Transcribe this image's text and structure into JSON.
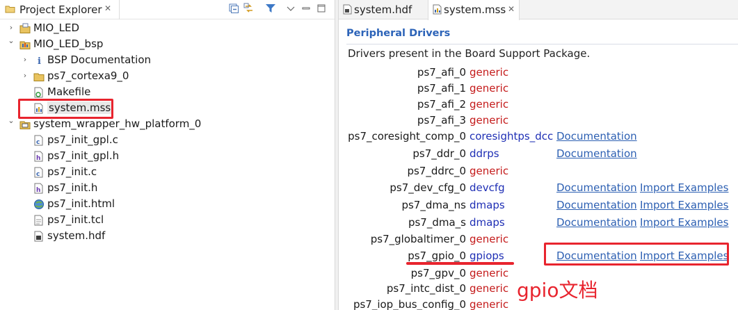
{
  "explorer": {
    "title": "Project Explorer",
    "close_glyph": "✕",
    "toolbar": [
      "collapse-all",
      "link-with-editor",
      "filter",
      "view-menu",
      "minimize",
      "maximize"
    ]
  },
  "tree": [
    {
      "label": "MIO_LED",
      "expanded": false,
      "icon": "project-folder-icon"
    },
    {
      "label": "MIO_LED_bsp",
      "expanded": true,
      "icon": "bsp-folder-icon"
    },
    {
      "label": "BSP Documentation",
      "expanded": false,
      "icon": "info-icon"
    },
    {
      "label": "ps7_cortexa9_0",
      "expanded": false,
      "icon": "folder-icon"
    },
    {
      "label": "Makefile",
      "icon": "makefile-icon"
    },
    {
      "label": "system.mss",
      "icon": "mss-file-icon",
      "selected": true
    },
    {
      "label": "system_wrapper_hw_platform_0",
      "expanded": true,
      "icon": "hw-platform-icon"
    },
    {
      "label": "ps7_init_gpl.c",
      "icon": "c-file-icon"
    },
    {
      "label": "ps7_init_gpl.h",
      "icon": "h-file-icon"
    },
    {
      "label": "ps7_init.c",
      "icon": "c-file-icon"
    },
    {
      "label": "ps7_init.h",
      "icon": "h-file-icon"
    },
    {
      "label": "ps7_init.html",
      "icon": "html-file-icon"
    },
    {
      "label": "ps7_init.tcl",
      "icon": "tcl-file-icon"
    },
    {
      "label": "system.hdf",
      "icon": "hdf-file-icon"
    }
  ],
  "editor": {
    "tabs": [
      {
        "label": "system.hdf",
        "icon": "hdf-file-icon",
        "active": false
      },
      {
        "label": "system.mss",
        "icon": "mss-file-icon",
        "active": true,
        "close_glyph": "✕"
      }
    ],
    "section_title": "Peripheral Drivers",
    "section_desc": "Drivers present in the Board Support Package.",
    "drivers": [
      {
        "name": "ps7_afi_0",
        "driver": "generic",
        "kind": "generic"
      },
      {
        "name": "ps7_afi_1",
        "driver": "generic",
        "kind": "generic"
      },
      {
        "name": "ps7_afi_2",
        "driver": "generic",
        "kind": "generic"
      },
      {
        "name": "ps7_afi_3",
        "driver": "generic",
        "kind": "generic"
      },
      {
        "name": "ps7_coresight_comp_0",
        "driver": "coresightps_dcc",
        "kind": "specific",
        "doc": "Documentation"
      },
      {
        "name": "ps7_ddr_0",
        "driver": "ddrps",
        "kind": "specific",
        "doc": "Documentation"
      },
      {
        "name": "ps7_ddrc_0",
        "driver": "generic",
        "kind": "generic"
      },
      {
        "name": "ps7_dev_cfg_0",
        "driver": "devcfg",
        "kind": "specific",
        "doc": "Documentation",
        "examples": "Import Examples"
      },
      {
        "name": "ps7_dma_ns",
        "driver": "dmaps",
        "kind": "specific",
        "doc": "Documentation",
        "examples": "Import Examples"
      },
      {
        "name": "ps7_dma_s",
        "driver": "dmaps",
        "kind": "specific",
        "doc": "Documentation",
        "examples": "Import Examples"
      },
      {
        "name": "ps7_globaltimer_0",
        "driver": "generic",
        "kind": "generic"
      },
      {
        "name": "ps7_gpio_0",
        "driver": "gpiops",
        "kind": "specific",
        "doc": "Documentation",
        "examples": "Import Examples"
      },
      {
        "name": "ps7_gpv_0",
        "driver": "generic",
        "kind": "generic"
      },
      {
        "name": "ps7_intc_dist_0",
        "driver": "generic",
        "kind": "generic"
      },
      {
        "name": "ps7_iop_bus_config_0",
        "driver": "generic",
        "kind": "generic"
      }
    ]
  },
  "annotation": {
    "text": "gpio文档",
    "color": "#e8242e"
  },
  "colors": {
    "section_title": "#2c63b8",
    "generic_driver": "#c41a1a",
    "specific_driver": "#1f2fb5",
    "link": "#2c5fb2",
    "highlight": "#e8242e"
  }
}
